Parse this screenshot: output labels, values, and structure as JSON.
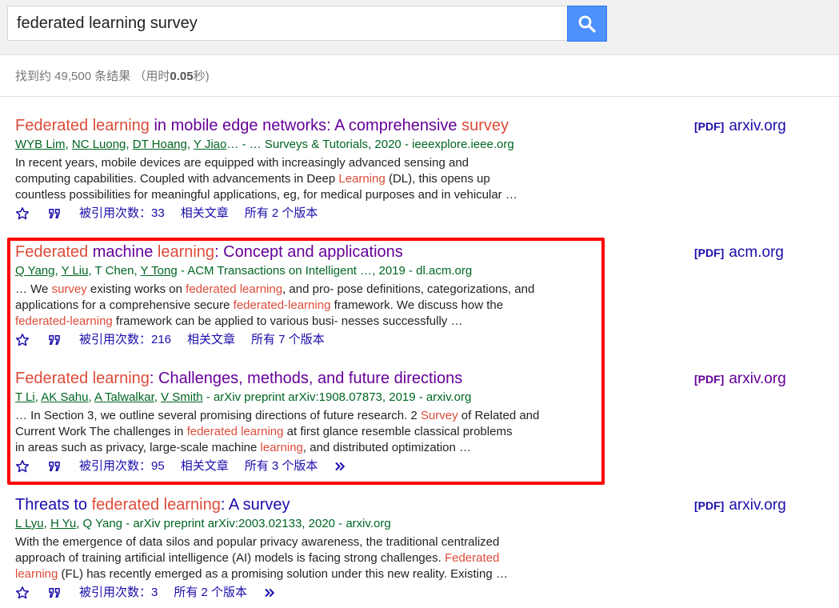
{
  "search": {
    "query": "federated learning survey"
  },
  "stats": {
    "prefix": "找到约 49,500 条结果 （用时",
    "time": "0.05",
    "suffix": "秒)"
  },
  "results": [
    {
      "title_parts": [
        {
          "t": "Federated learning",
          "c": "h"
        },
        {
          "t": " in mobile edge networks: A comprehensive ",
          "c": "v"
        },
        {
          "t": "survey",
          "c": "h"
        }
      ],
      "author_parts": [
        {
          "t": "WYB Lim",
          "u": true
        },
        {
          "t": ", "
        },
        {
          "t": "NC Luong",
          "u": true
        },
        {
          "t": ", "
        },
        {
          "t": "DT Hoang",
          "u": true
        },
        {
          "t": ", "
        },
        {
          "t": "Y Jiao",
          "u": true
        },
        {
          "t": "… - … Surveys & Tutorials, 2020 - ieeexplore.ieee.org"
        }
      ],
      "snippet_lines": [
        [
          {
            "t": "In recent years, mobile devices are equipped with increasingly advanced sensing and"
          }
        ],
        [
          {
            "t": "computing capabilities. Coupled with advancements in Deep "
          },
          {
            "t": "Learning",
            "h": true
          },
          {
            "t": " (DL), this opens up"
          }
        ],
        [
          {
            "t": "countless possibilities for meaningful applications, eg, for medical purposes and in vehicular …"
          }
        ]
      ],
      "cited": "被引用次数：33",
      "related": "相关文章",
      "versions": "所有 2 个版本",
      "more": false,
      "pdf_tag": "[PDF]",
      "pdf_domain": "arxiv.org",
      "pdf_visited": false
    },
    {
      "title_parts": [
        {
          "t": "Federated",
          "c": "h"
        },
        {
          "t": " machine ",
          "c": "v"
        },
        {
          "t": "learning",
          "c": "h"
        },
        {
          "t": ": Concept and applications",
          "c": "v"
        }
      ],
      "author_parts": [
        {
          "t": "Q Yang",
          "u": true
        },
        {
          "t": ", "
        },
        {
          "t": "Y Liu",
          "u": true
        },
        {
          "t": ", T Chen, "
        },
        {
          "t": "Y Tong",
          "u": true
        },
        {
          "t": " - ACM Transactions on Intelligent …, 2019 - dl.acm.org"
        }
      ],
      "snippet_lines": [
        [
          {
            "t": "… We "
          },
          {
            "t": "survey",
            "h": true
          },
          {
            "t": " existing works on "
          },
          {
            "t": "federated learning",
            "h": true
          },
          {
            "t": ", and pro- pose definitions, categorizations, and"
          }
        ],
        [
          {
            "t": "applications for a comprehensive secure "
          },
          {
            "t": "federated-learning",
            "h": true
          },
          {
            "t": " framework. We discuss how the"
          }
        ],
        [
          {
            "t": "federated-learning",
            "h": true
          },
          {
            "t": " framework can be applied to various busi- nesses successfully …"
          }
        ]
      ],
      "cited": "被引用次数：216",
      "related": "相关文章",
      "versions": "所有 7 个版本",
      "more": false,
      "pdf_tag": "[PDF]",
      "pdf_domain": "acm.org",
      "pdf_visited": false
    },
    {
      "title_parts": [
        {
          "t": "Federated learning",
          "c": "h"
        },
        {
          "t": ": Challenges, methods, and future directions",
          "c": "v"
        }
      ],
      "author_parts": [
        {
          "t": "T Li",
          "u": true
        },
        {
          "t": ", "
        },
        {
          "t": "AK Sahu",
          "u": true
        },
        {
          "t": ", "
        },
        {
          "t": "A Talwalkar",
          "u": true
        },
        {
          "t": ", "
        },
        {
          "t": "V Smith",
          "u": true
        },
        {
          "t": " - arXiv preprint arXiv:1908.07873, 2019 - arxiv.org"
        }
      ],
      "snippet_lines": [
        [
          {
            "t": "… In Section 3, we outline several promising directions of future research. 2 "
          },
          {
            "t": "Survey",
            "h": true
          },
          {
            "t": " of Related and"
          }
        ],
        [
          {
            "t": "Current Work The challenges in "
          },
          {
            "t": "federated learning",
            "h": true
          },
          {
            "t": " at first glance resemble classical problems"
          }
        ],
        [
          {
            "t": "in areas such as privacy, large-scale machine "
          },
          {
            "t": "learning",
            "h": true
          },
          {
            "t": ", and distributed optimization …"
          }
        ]
      ],
      "cited": "被引用次数：95",
      "related": "相关文章",
      "versions": "所有 3 个版本",
      "more": true,
      "pdf_tag": "[PDF]",
      "pdf_domain": "arxiv.org",
      "pdf_visited": true
    },
    {
      "title_parts": [
        {
          "t": "Threats to ",
          "c": "n"
        },
        {
          "t": "federated learning",
          "c": "h"
        },
        {
          "t": ": A survey",
          "c": "n"
        }
      ],
      "author_parts": [
        {
          "t": "L Lyu",
          "u": true
        },
        {
          "t": ", "
        },
        {
          "t": "H Yu",
          "u": true
        },
        {
          "t": ", Q Yang - arXiv preprint arXiv:2003.02133, 2020 - arxiv.org"
        }
      ],
      "snippet_lines": [
        [
          {
            "t": "With the emergence of data silos and popular privacy awareness, the traditional centralized"
          }
        ],
        [
          {
            "t": "approach of training artificial intelligence (AI) models is facing strong challenges. "
          },
          {
            "t": "Federated",
            "h": true
          }
        ],
        [
          {
            "t": "learning",
            "h": true
          },
          {
            "t": " (FL) has recently emerged as a promising solution under this new reality. Existing …"
          }
        ]
      ],
      "cited": "被引用次数：3",
      "related": "",
      "versions": "所有 2 个版本",
      "more": true,
      "pdf_tag": "[PDF]",
      "pdf_domain": "arxiv.org",
      "pdf_visited": false
    }
  ],
  "colors": {
    "link": "#1a0dab",
    "visited": "#660099",
    "highlight": "#dd4b39",
    "author": "#006621",
    "annotation_box": "#ff0000"
  },
  "icons": [
    "search-icon",
    "star-icon",
    "quote-icon",
    "more-icon"
  ]
}
